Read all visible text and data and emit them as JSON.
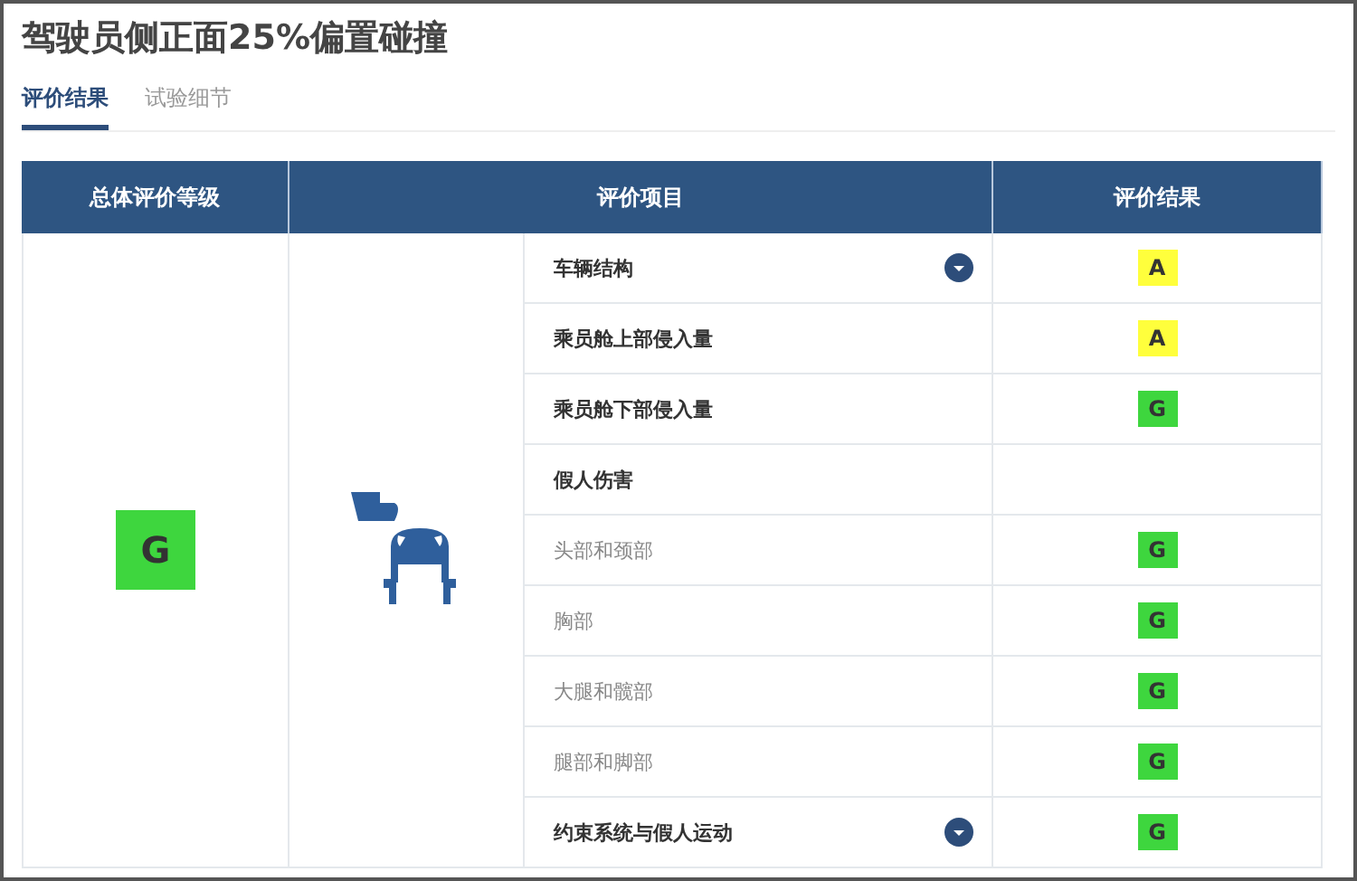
{
  "title": "驾驶员侧正面25%偏置碰撞",
  "tabs": [
    {
      "label": "评价结果",
      "selected": true
    },
    {
      "label": "试验细节",
      "selected": false
    }
  ],
  "table": {
    "columns": [
      "总体评价等级",
      "评价项目",
      "评价结果"
    ],
    "overall": {
      "grade": "G",
      "color": "#3ed63e"
    },
    "rows": [
      {
        "item": "车辆结构",
        "kind": "main",
        "expandable": true,
        "grade": "A",
        "color": "#ffff3c"
      },
      {
        "item": "乘员舱上部侵入量",
        "kind": "main",
        "expandable": false,
        "grade": "A",
        "color": "#ffff3c"
      },
      {
        "item": "乘员舱下部侵入量",
        "kind": "main",
        "expandable": false,
        "grade": "G",
        "color": "#3ed63e"
      },
      {
        "item": "假人伤害",
        "kind": "main",
        "expandable": false
      },
      {
        "item": "头部和颈部",
        "kind": "sub",
        "expandable": false,
        "grade": "G",
        "color": "#3ed63e"
      },
      {
        "item": "胸部",
        "kind": "sub",
        "expandable": false,
        "grade": "G",
        "color": "#3ed63e"
      },
      {
        "item": "大腿和髋部",
        "kind": "sub",
        "expandable": false,
        "grade": "G",
        "color": "#3ed63e"
      },
      {
        "item": "腿部和脚部",
        "kind": "sub",
        "expandable": false,
        "grade": "G",
        "color": "#3ed63e"
      },
      {
        "item": "约束系统与假人运动",
        "kind": "main",
        "expandable": true,
        "grade": "G",
        "color": "#3ed63e"
      }
    ]
  }
}
